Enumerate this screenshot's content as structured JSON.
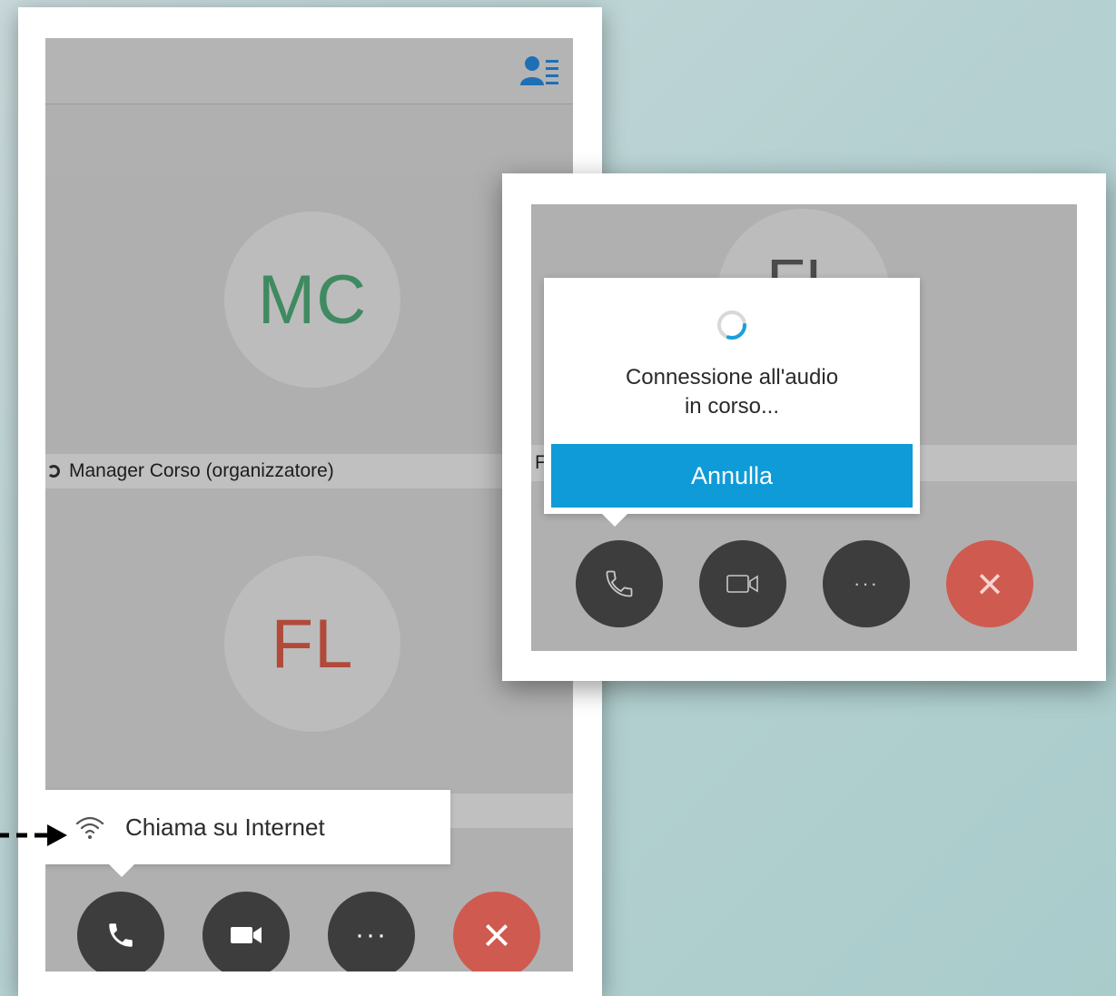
{
  "left": {
    "participants": [
      {
        "initials": "MC",
        "name": "Manager Corso (organizzatore)"
      },
      {
        "initials": "FL"
      }
    ],
    "tooltip": {
      "label": "Chiama su Internet"
    },
    "controls": {
      "more_label": "···",
      "end_label": "×"
    },
    "icons": [
      "participants-list-icon",
      "wifi-icon",
      "phone-icon",
      "video-camera-icon",
      "more-icon",
      "close-icon",
      "arrow-right-icon"
    ]
  },
  "right": {
    "avatar_initials": "FL",
    "namebar_text": "F",
    "dialog": {
      "message_line1": "Connessione all'audio",
      "message_line2": "in corso...",
      "cancel_label": "Annulla"
    },
    "controls": {
      "more_label": "···",
      "end_label": "×"
    },
    "icons": [
      "spinner-icon",
      "phone-icon",
      "video-camera-icon",
      "more-icon",
      "close-icon"
    ]
  },
  "colors": {
    "accent": "#0f9bd7",
    "end_call": "#cf5a4f",
    "control_dark": "#3d3d3d",
    "mc_initials": "#3f8a61",
    "fl_initials": "#b24a3a"
  }
}
